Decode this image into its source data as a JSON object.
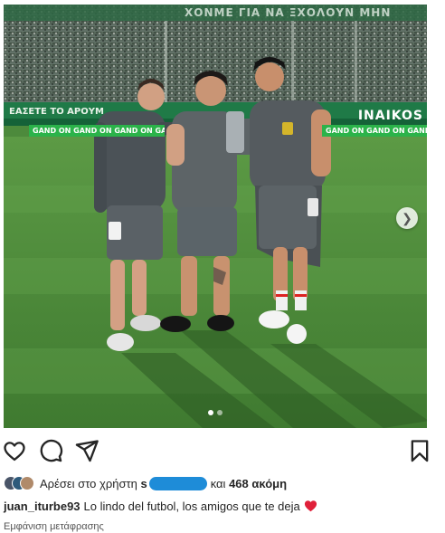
{
  "photo": {
    "stadium_sign": "ΧΟΝΜΕ ΓΙΑ ΝΑ ΞΧΟΛΟΥΝ ΜΗΝ",
    "board_left": "ΕΑΣΕΤΕ ΤΟ ΑΡΟΥΜ",
    "board_right": "INAIKOS",
    "ad_text": "GAND ON  GAND ON  GAND ON  GAND ON  GAND ON",
    "carousel_dots": 2,
    "carousel_active_index": 0
  },
  "actions": {
    "like_icon": "heart-outline-icon",
    "comment_icon": "comment-icon",
    "share_icon": "paper-plane-icon",
    "save_icon": "bookmark-icon"
  },
  "likes": {
    "prefix": "Αρέσει στο χρήστη",
    "user_partial": "s",
    "connector": "και",
    "count_text": "468 ακόμη"
  },
  "caption": {
    "username": "juan_iturbe93",
    "text": "Lo lindo del futbol, los amigos que te deja",
    "emoji": "red-heart-emoji"
  },
  "translation_link": "Εμφάνιση μετάφρασης",
  "colors": {
    "pitch": "#4d8a3c",
    "accent_green": "#2bb34a",
    "redaction": "#1e8cd8",
    "heart_red": "#e0203a"
  }
}
